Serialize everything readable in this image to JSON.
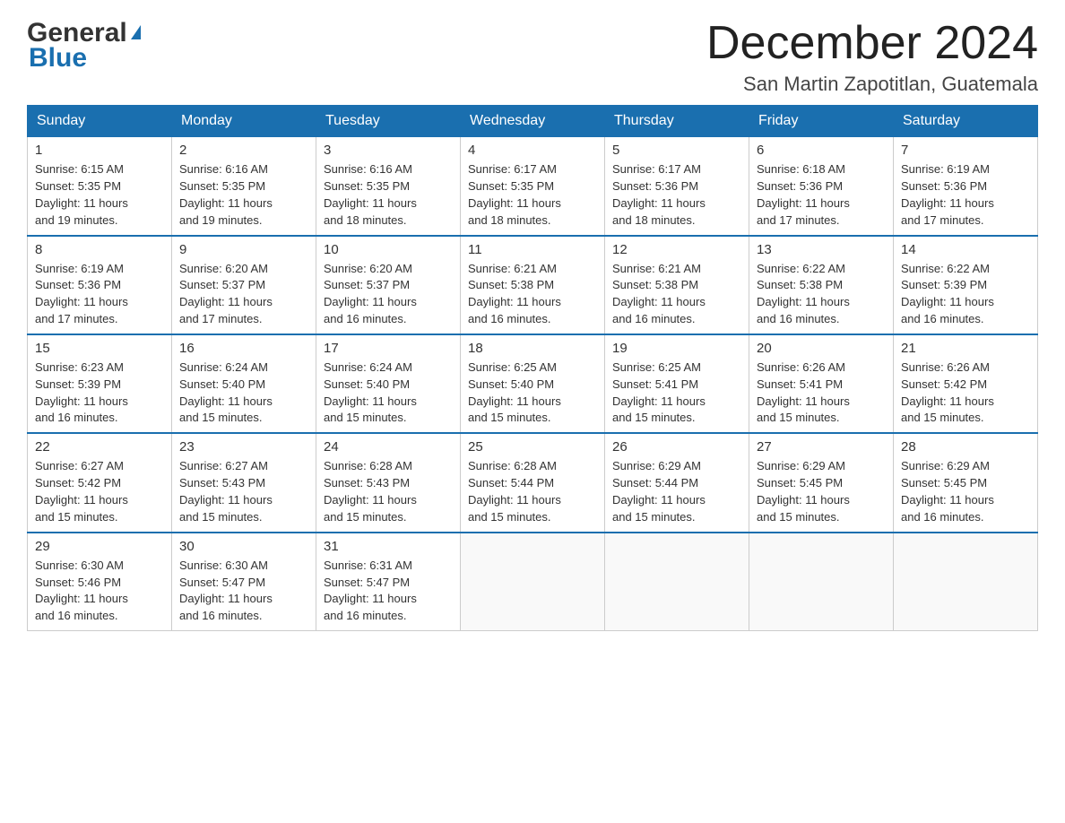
{
  "header": {
    "logo_general": "General",
    "logo_blue": "Blue",
    "month_title": "December 2024",
    "location": "San Martin Zapotitlan, Guatemala"
  },
  "days_of_week": [
    "Sunday",
    "Monday",
    "Tuesday",
    "Wednesday",
    "Thursday",
    "Friday",
    "Saturday"
  ],
  "weeks": [
    [
      {
        "day": "1",
        "sunrise": "6:15 AM",
        "sunset": "5:35 PM",
        "daylight": "11 hours and 19 minutes."
      },
      {
        "day": "2",
        "sunrise": "6:16 AM",
        "sunset": "5:35 PM",
        "daylight": "11 hours and 19 minutes."
      },
      {
        "day": "3",
        "sunrise": "6:16 AM",
        "sunset": "5:35 PM",
        "daylight": "11 hours and 18 minutes."
      },
      {
        "day": "4",
        "sunrise": "6:17 AM",
        "sunset": "5:35 PM",
        "daylight": "11 hours and 18 minutes."
      },
      {
        "day": "5",
        "sunrise": "6:17 AM",
        "sunset": "5:36 PM",
        "daylight": "11 hours and 18 minutes."
      },
      {
        "day": "6",
        "sunrise": "6:18 AM",
        "sunset": "5:36 PM",
        "daylight": "11 hours and 17 minutes."
      },
      {
        "day": "7",
        "sunrise": "6:19 AM",
        "sunset": "5:36 PM",
        "daylight": "11 hours and 17 minutes."
      }
    ],
    [
      {
        "day": "8",
        "sunrise": "6:19 AM",
        "sunset": "5:36 PM",
        "daylight": "11 hours and 17 minutes."
      },
      {
        "day": "9",
        "sunrise": "6:20 AM",
        "sunset": "5:37 PM",
        "daylight": "11 hours and 17 minutes."
      },
      {
        "day": "10",
        "sunrise": "6:20 AM",
        "sunset": "5:37 PM",
        "daylight": "11 hours and 16 minutes."
      },
      {
        "day": "11",
        "sunrise": "6:21 AM",
        "sunset": "5:38 PM",
        "daylight": "11 hours and 16 minutes."
      },
      {
        "day": "12",
        "sunrise": "6:21 AM",
        "sunset": "5:38 PM",
        "daylight": "11 hours and 16 minutes."
      },
      {
        "day": "13",
        "sunrise": "6:22 AM",
        "sunset": "5:38 PM",
        "daylight": "11 hours and 16 minutes."
      },
      {
        "day": "14",
        "sunrise": "6:22 AM",
        "sunset": "5:39 PM",
        "daylight": "11 hours and 16 minutes."
      }
    ],
    [
      {
        "day": "15",
        "sunrise": "6:23 AM",
        "sunset": "5:39 PM",
        "daylight": "11 hours and 16 minutes."
      },
      {
        "day": "16",
        "sunrise": "6:24 AM",
        "sunset": "5:40 PM",
        "daylight": "11 hours and 15 minutes."
      },
      {
        "day": "17",
        "sunrise": "6:24 AM",
        "sunset": "5:40 PM",
        "daylight": "11 hours and 15 minutes."
      },
      {
        "day": "18",
        "sunrise": "6:25 AM",
        "sunset": "5:40 PM",
        "daylight": "11 hours and 15 minutes."
      },
      {
        "day": "19",
        "sunrise": "6:25 AM",
        "sunset": "5:41 PM",
        "daylight": "11 hours and 15 minutes."
      },
      {
        "day": "20",
        "sunrise": "6:26 AM",
        "sunset": "5:41 PM",
        "daylight": "11 hours and 15 minutes."
      },
      {
        "day": "21",
        "sunrise": "6:26 AM",
        "sunset": "5:42 PM",
        "daylight": "11 hours and 15 minutes."
      }
    ],
    [
      {
        "day": "22",
        "sunrise": "6:27 AM",
        "sunset": "5:42 PM",
        "daylight": "11 hours and 15 minutes."
      },
      {
        "day": "23",
        "sunrise": "6:27 AM",
        "sunset": "5:43 PM",
        "daylight": "11 hours and 15 minutes."
      },
      {
        "day": "24",
        "sunrise": "6:28 AM",
        "sunset": "5:43 PM",
        "daylight": "11 hours and 15 minutes."
      },
      {
        "day": "25",
        "sunrise": "6:28 AM",
        "sunset": "5:44 PM",
        "daylight": "11 hours and 15 minutes."
      },
      {
        "day": "26",
        "sunrise": "6:29 AM",
        "sunset": "5:44 PM",
        "daylight": "11 hours and 15 minutes."
      },
      {
        "day": "27",
        "sunrise": "6:29 AM",
        "sunset": "5:45 PM",
        "daylight": "11 hours and 15 minutes."
      },
      {
        "day": "28",
        "sunrise": "6:29 AM",
        "sunset": "5:45 PM",
        "daylight": "11 hours and 16 minutes."
      }
    ],
    [
      {
        "day": "29",
        "sunrise": "6:30 AM",
        "sunset": "5:46 PM",
        "daylight": "11 hours and 16 minutes."
      },
      {
        "day": "30",
        "sunrise": "6:30 AM",
        "sunset": "5:47 PM",
        "daylight": "11 hours and 16 minutes."
      },
      {
        "day": "31",
        "sunrise": "6:31 AM",
        "sunset": "5:47 PM",
        "daylight": "11 hours and 16 minutes."
      },
      null,
      null,
      null,
      null
    ]
  ],
  "labels": {
    "sunrise": "Sunrise:",
    "sunset": "Sunset:",
    "daylight": "Daylight:"
  }
}
